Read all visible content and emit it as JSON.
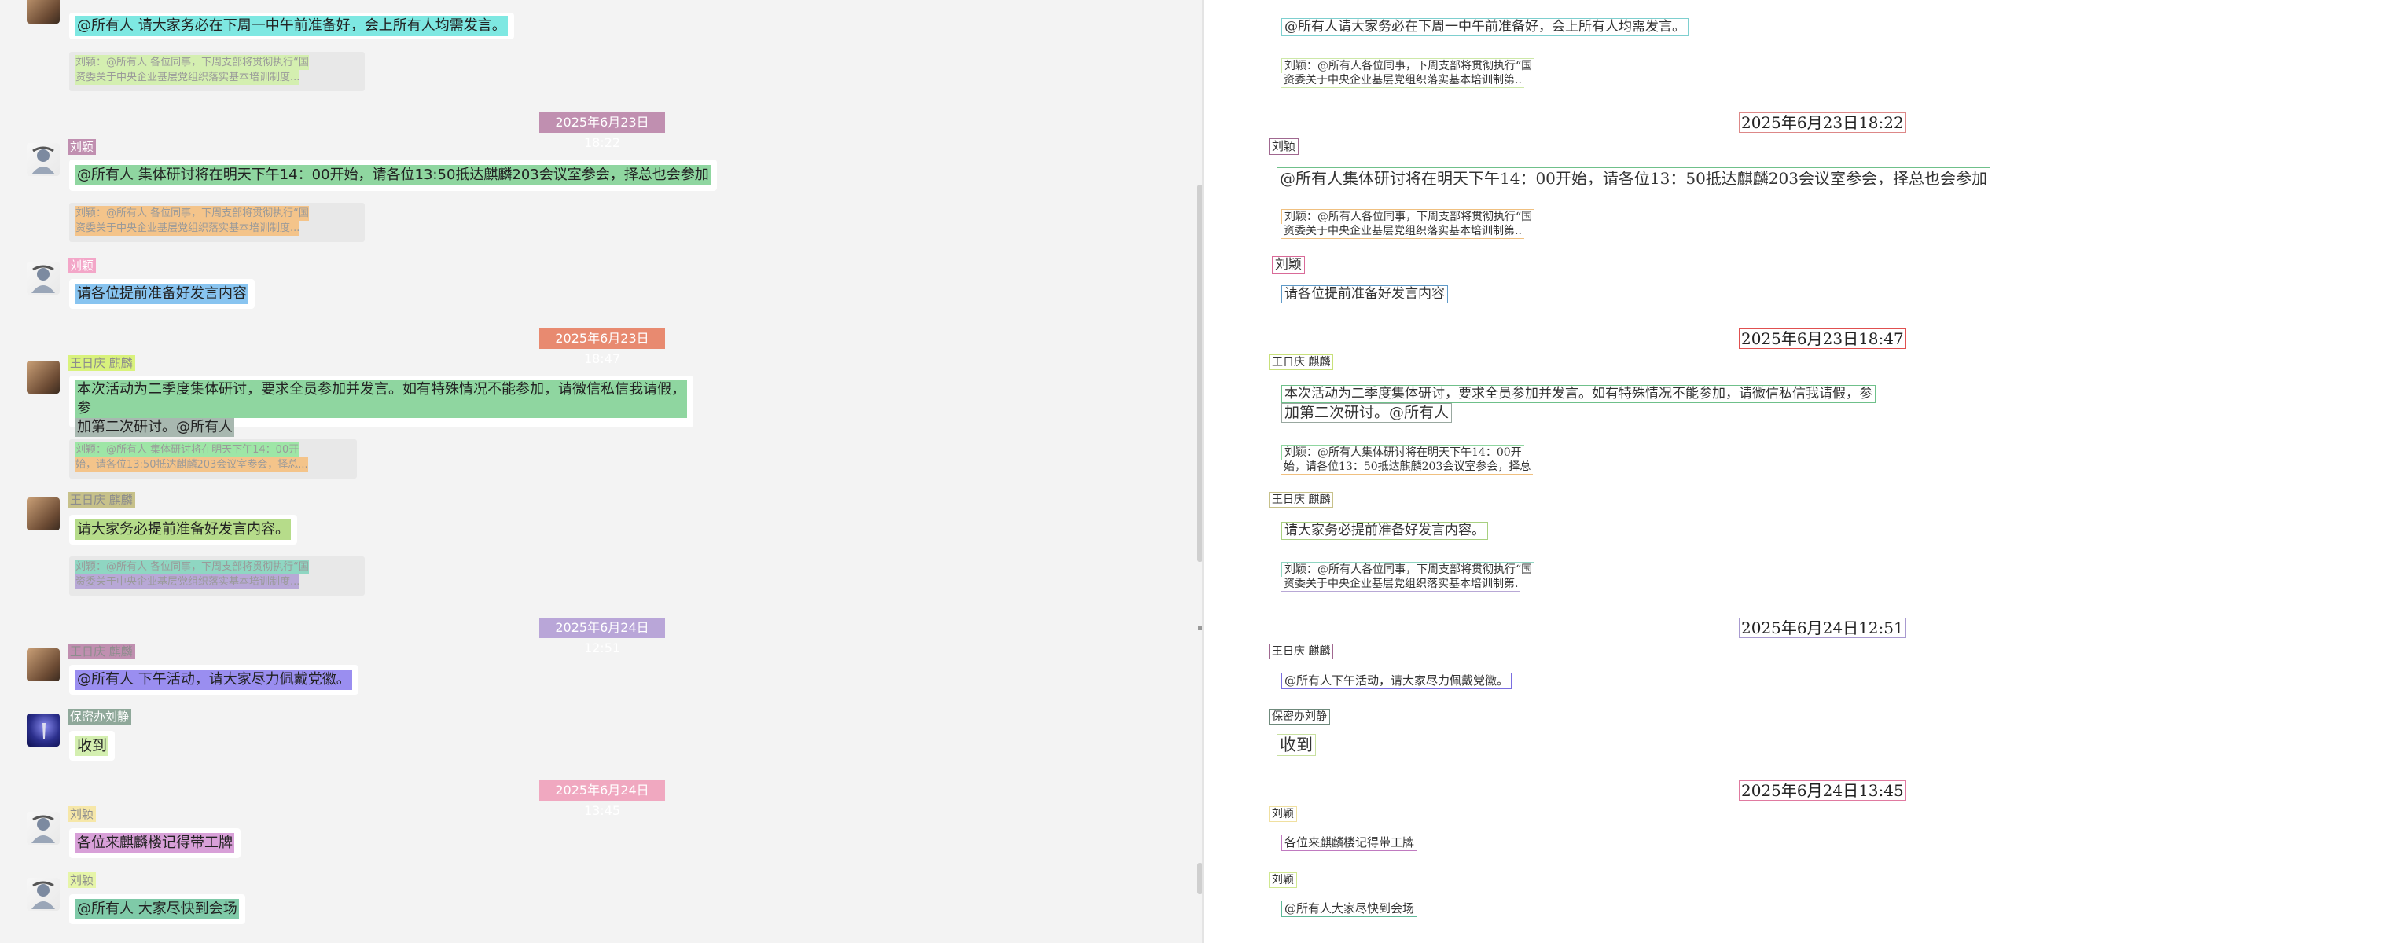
{
  "left": {
    "messages": [
      {
        "text": "@所有人 请大家务必在下周一中午前准备好，会上所有人均需发言。"
      },
      {
        "quote1": "刘颖：@所有人 各位同事，下周支部将贯彻执行“国",
        "quote2": "资委关于中央企业基层党组织落实基本培训制度..."
      },
      {
        "time": "2025年6月23日 18:22"
      },
      {
        "name": "刘颖",
        "text": "@所有人 集体研讨将在明天下午14：00开始，请各位13:50抵达麒麟203会议室参会，择总也会参加"
      },
      {
        "quote1": "刘颖：@所有人 各位同事，下周支部将贯彻执行“国",
        "quote2": "资委关于中央企业基层党组织落实基本培训制度..."
      },
      {
        "name": "刘颖",
        "text": "请各位提前准备好发言内容"
      },
      {
        "time": "2025年6月23日 18:47"
      },
      {
        "name": "王日庆 麒麟",
        "text1": "本次活动为二季度集体研讨，要求全员参加并发言。如有特殊情况不能参加，请微信私信我请假，参",
        "text2": "加第二次研讨。@所有人"
      },
      {
        "quote1": "刘颖：@所有人 集体研讨将在明天下午14：00开",
        "quote2": "始，请各位13:50抵达麒麟203会议室参会，择总..."
      },
      {
        "name": "王日庆 麒麟",
        "text": "请大家务必提前准备好发言内容。"
      },
      {
        "quote1": "刘颖：@所有人 各位同事，下周支部将贯彻执行“国",
        "quote2": "资委关于中央企业基层党组织落实基本培训制度..."
      },
      {
        "time": "2025年6月24日 12:51"
      },
      {
        "name": "王日庆 麒麟",
        "text": "@所有人 下午活动，请大家尽力佩戴党徽。"
      },
      {
        "name": "保密办刘静",
        "text": "收到"
      },
      {
        "time": "2025年6月24日 13:45"
      },
      {
        "name": "刘颖",
        "text": "各位来麒麟楼记得带工牌"
      },
      {
        "name": "刘颖",
        "text": "@所有人 大家尽快到会场"
      }
    ]
  },
  "right": {
    "items": [
      "@所有人请大家务必在下周一中午前准备好，会上所有人均需发言。",
      "刘颖：@所有人各位同事，下周支部将贯彻执行“国",
      "资委关于中央企业基层党组织落实基本培训制第..",
      "2025年6月23日18:22",
      "刘颖",
      "@所有人集体研讨将在明天下午14：00开始，请各位13：50抵达麒麟203会议室参会，择总也会参加",
      "刘颖：@所有人各位同事，下周支部将贯彻执行“国",
      "资委关于中央企业基层党组织落实基本培训制第..",
      "刘颖",
      "请各位提前准备好发言内容",
      "2025年6月23日18:47",
      "王日庆 麒麟",
      "本次活动为二季度集体研讨，要求全员参加并发言。如有特殊情况不能参加，请微信私信我请假，参",
      "加第二次研讨。@所有人",
      "刘颖：@所有人集体研讨将在明天下午14：00开",
      "始，请各位13：50抵达麒麟203会议室参会，择总",
      "王日庆 麒麟",
      "请大家务必提前准备好发言内容。",
      "刘颖：@所有人各位同事，下周支部将贯彻执行“国",
      "资委关于中央企业基层党组织落实基本培训制第.",
      "2025年6月24日12:51",
      "王日庆 麒麟",
      "@所有人下午活动，请大家尽力佩戴党徽。",
      "保密办刘静",
      "收到",
      "2025年6月24日13:45",
      "刘颖",
      "各位来麒麟楼记得带工牌",
      "刘颖",
      "@所有人大家尽快到会场"
    ]
  },
  "colors": {
    "hl_cyan": "#7ee8e2",
    "hl_yellowgreen": "#d4efb0",
    "hl_mauve": "#c08fb0",
    "hl_green": "#8fd6a0",
    "hl_orange": "#f4c48a",
    "hl_pink": "#f3a6c8",
    "hl_blue": "#88c4f0",
    "hl_salmon": "#e88a70",
    "hl_lime": "#d9f27c",
    "hl_purple": "#b9a6f2",
    "hl_violet": "#9a8ef0",
    "hl_gray": "#a8b8b0"
  }
}
